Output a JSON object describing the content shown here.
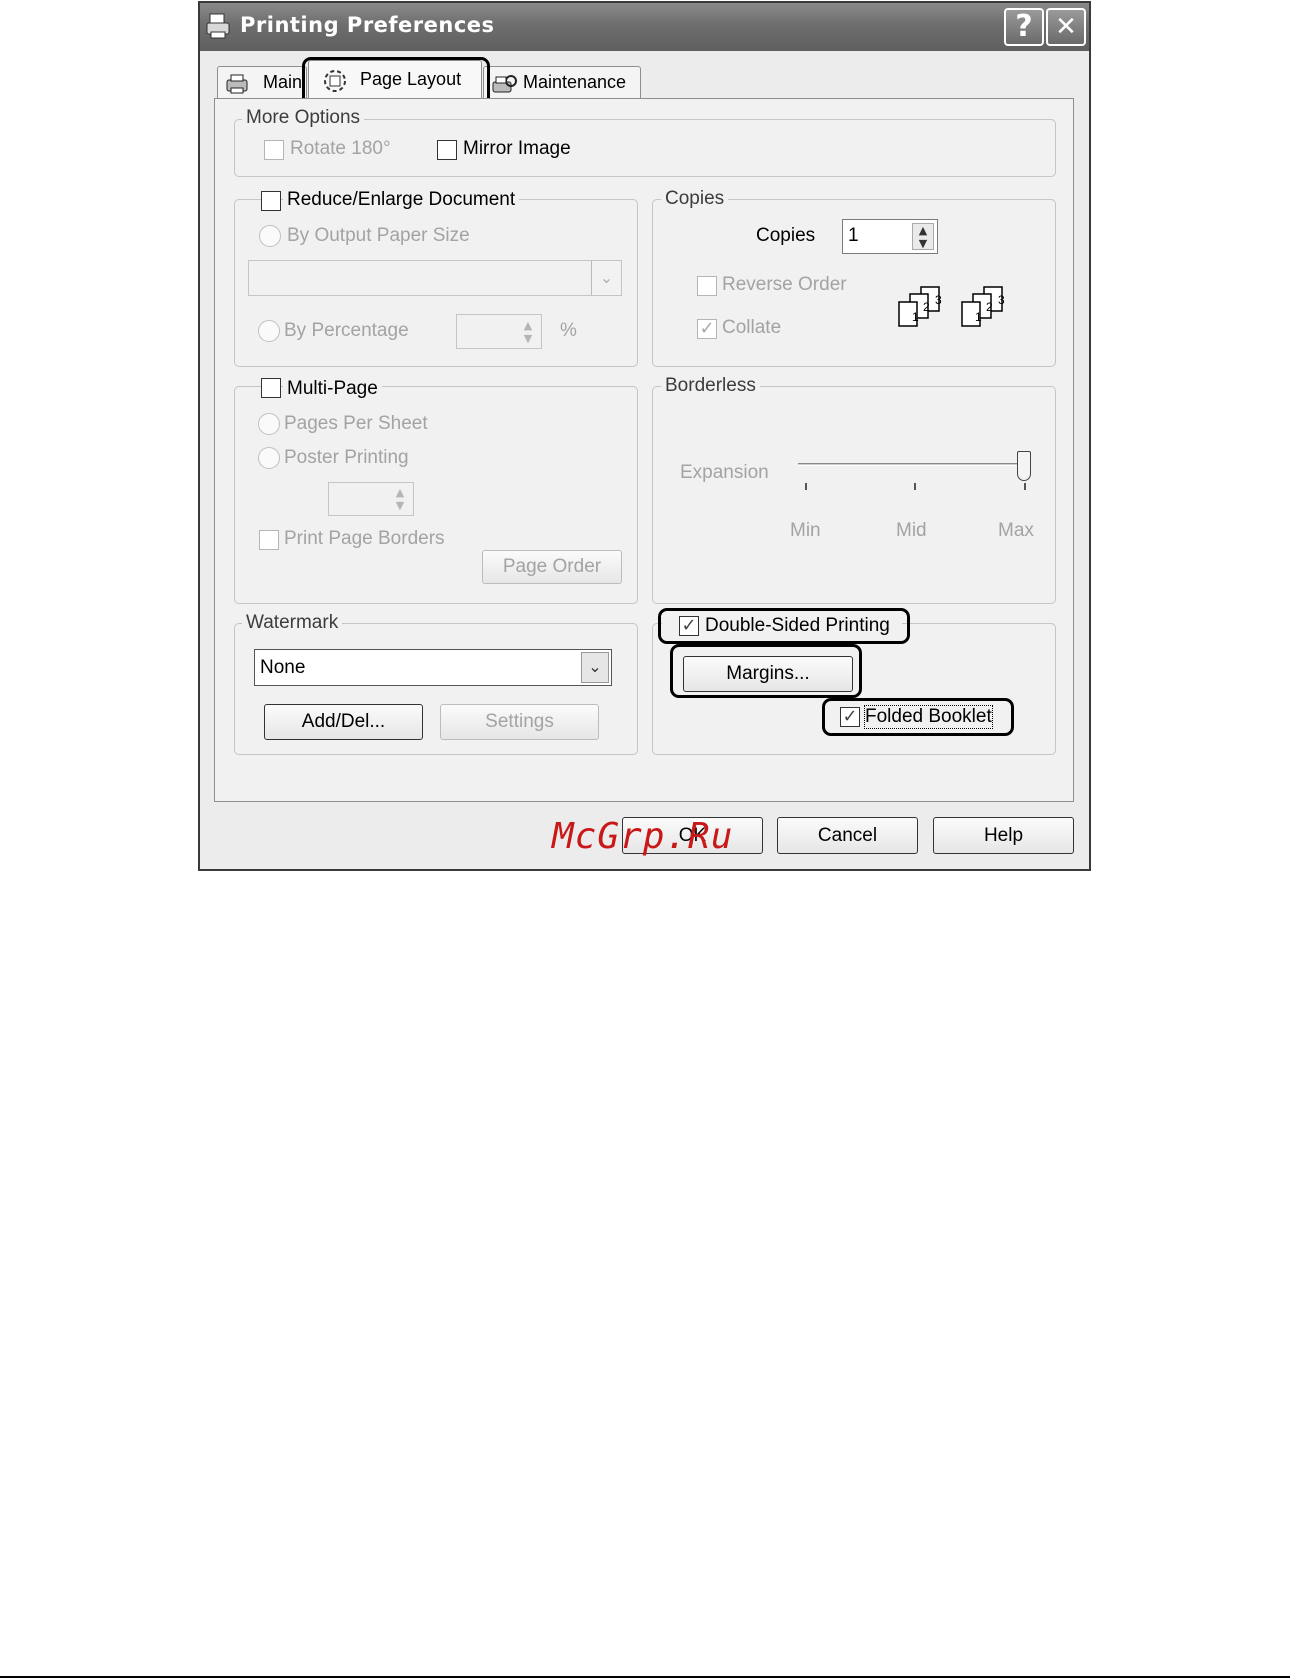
{
  "window": {
    "title": "Printing Preferences",
    "help_label": "?",
    "close_label": "✕"
  },
  "tabs": [
    {
      "label": "Main",
      "icon": "printer-icon"
    },
    {
      "label": "Page Layout",
      "icon": "page-layout-icon",
      "selected": true
    },
    {
      "label": "Maintenance",
      "icon": "maintenance-icon"
    }
  ],
  "more_options": {
    "label": "More Options",
    "rotate": {
      "label": "Rotate 180°",
      "checked": false,
      "enabled": false
    },
    "mirror": {
      "label": "Mirror Image",
      "checked": false,
      "enabled": true
    }
  },
  "reduce_enlarge": {
    "label": "Reduce/Enlarge Document",
    "checked": false,
    "by_output": "By Output Paper Size",
    "paper_size_value": "",
    "by_percentage": "By Percentage",
    "percent_value": "",
    "percent_unit": "%"
  },
  "copies": {
    "group_label": "Copies",
    "label": "Copies",
    "value": "1",
    "reverse_order": {
      "label": "Reverse Order",
      "checked": false
    },
    "collate": {
      "label": "Collate",
      "checked": true
    },
    "collate_icon_digits": [
      "1",
      "2",
      "3"
    ]
  },
  "multi_page": {
    "label": "Multi-Page",
    "checked": false,
    "pages_per_sheet": "Pages Per Sheet",
    "poster_printing": "Poster Printing",
    "poster_value": "",
    "print_page_borders": "Print Page Borders",
    "page_order": "Page Order"
  },
  "borderless": {
    "label": "Borderless",
    "expansion": "Expansion",
    "ticks": [
      "Min",
      "Mid",
      "Max"
    ],
    "level": "Max"
  },
  "watermark": {
    "label": "Watermark",
    "value": "None",
    "add_del": "Add/Del...",
    "settings": "Settings"
  },
  "double_sided": {
    "label": "Double-Sided Printing",
    "checked": true,
    "margins": "Margins...",
    "folded_booklet": {
      "label": "Folded Booklet",
      "checked": true
    }
  },
  "footer": {
    "ok": "OK",
    "cancel": "Cancel",
    "help": "Help"
  },
  "overlay_watermark": "McGrp.Ru",
  "colors": {
    "titlebar": "#6e6e6e",
    "dialog_bg": "#ececec",
    "watermark_red": "#c81818"
  }
}
